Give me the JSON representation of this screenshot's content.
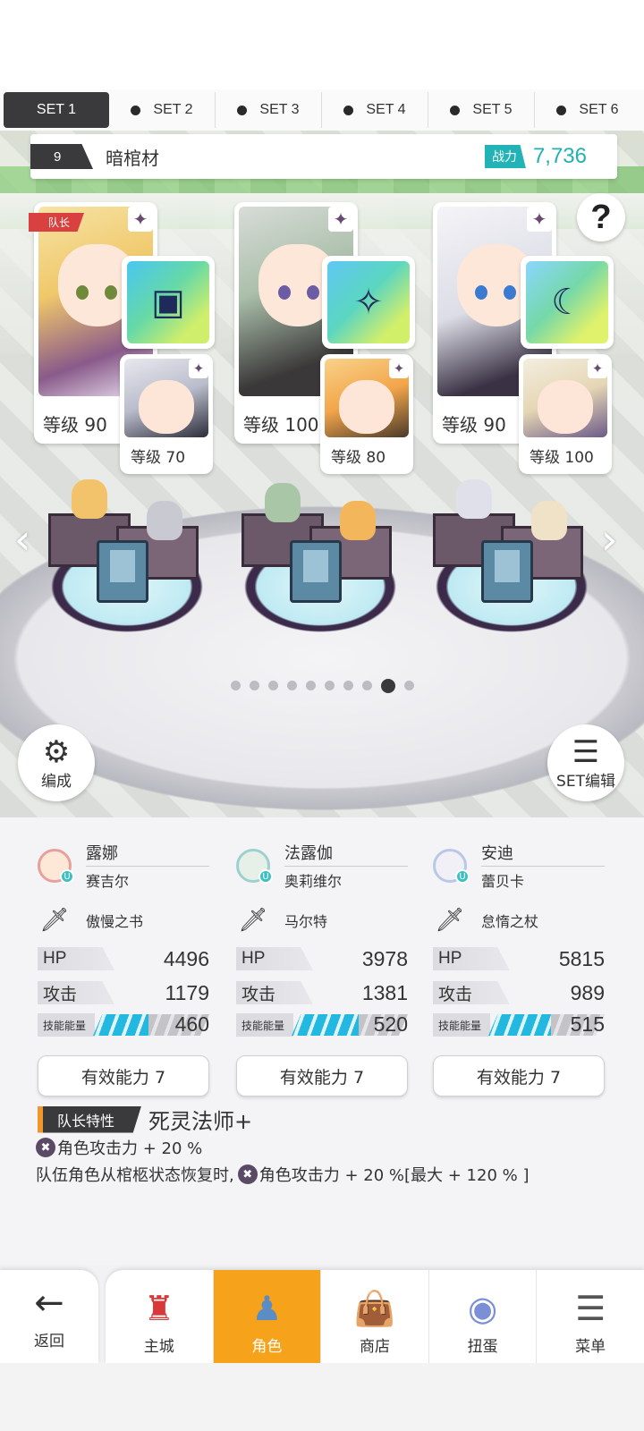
{
  "set_tabs": [
    {
      "label": "SET 1",
      "active": true
    },
    {
      "label": "SET 2",
      "active": false
    },
    {
      "label": "SET 3",
      "active": false
    },
    {
      "label": "SET 4",
      "active": false
    },
    {
      "label": "SET 5",
      "active": false
    },
    {
      "label": "SET 6",
      "active": false
    }
  ],
  "team": {
    "number": "9",
    "name": "暗棺材",
    "power_label": "战力",
    "power_value": "7,736"
  },
  "help_icon": "?",
  "heroes": [
    {
      "leader_badge": "队长",
      "main_level": "等级 90",
      "sub_level": "等级 70",
      "weapon_icon": "book-icon"
    },
    {
      "leader_badge": "",
      "main_level": "等级 100",
      "sub_level": "等级 80",
      "weapon_icon": "spear-icon"
    },
    {
      "leader_badge": "",
      "main_level": "等级 90",
      "sub_level": "等级 100",
      "weapon_icon": "scythe-staff-icon"
    }
  ],
  "page_dots": {
    "count": 10,
    "active_index": 8
  },
  "buttons": {
    "formation": "编成",
    "set_edit": "SET编辑"
  },
  "stats": [
    {
      "hero": "露娜",
      "sub": "赛吉尔",
      "weapon": "傲慢之书",
      "hp_label": "HP",
      "hp": "4496",
      "atk_label": "攻击",
      "atk": "1179",
      "energy_label": "技能能量",
      "energy": "460",
      "effective": "有效能力 7"
    },
    {
      "hero": "法露伽",
      "sub": "奥莉维尔",
      "weapon": "马尔特",
      "hp_label": "HP",
      "hp": "3978",
      "atk_label": "攻击",
      "atk": "1381",
      "energy_label": "技能能量",
      "energy": "520",
      "effective": "有效能力 7"
    },
    {
      "hero": "安迪",
      "sub": "蕾贝卡",
      "weapon": "怠惰之杖",
      "hp_label": "HP",
      "hp": "5815",
      "atk_label": "攻击",
      "atk": "989",
      "energy_label": "技能能量",
      "energy": "515",
      "effective": "有效能力 7"
    }
  ],
  "leader_trait": {
    "tag": "队长特性",
    "name": "死灵法师+",
    "line1": "角色攻击力 + 20 %",
    "line2_prefix": "队伍角色从棺柩状态恢复时,",
    "line2_suffix": "角色攻击力 + 20 %[最大 + 120 % ]"
  },
  "nav": {
    "back": "返回",
    "items": [
      {
        "label": "主城",
        "active": false
      },
      {
        "label": "角色",
        "active": true
      },
      {
        "label": "商店",
        "active": false
      },
      {
        "label": "扭蛋",
        "active": false
      },
      {
        "label": "菜单",
        "active": false
      }
    ]
  },
  "colors": {
    "accent_teal": "#22b3b6",
    "active_tab": "#3a3a3c",
    "nav_active": "#f7a21b",
    "leader_red": "#d94040",
    "energy_blue": "#23b8e0"
  }
}
